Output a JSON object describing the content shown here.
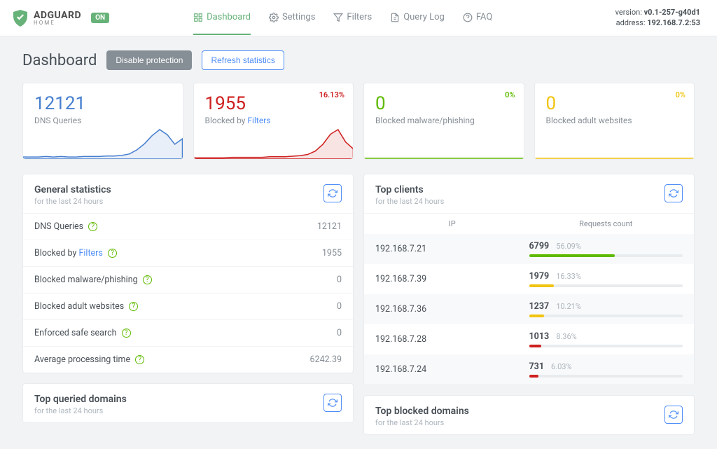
{
  "header": {
    "brand_main": "ADGUARD",
    "brand_sub": "HOME",
    "status_badge": "ON",
    "version_label": "version:",
    "version": "v0.1-257-g40d1",
    "address_label": "address:",
    "address": "192.168.7.2:53"
  },
  "nav": {
    "dashboard": "Dashboard",
    "settings": "Settings",
    "filters": "Filters",
    "querylog": "Query Log",
    "faq": "FAQ"
  },
  "page": {
    "title": "Dashboard",
    "disable_btn": "Disable protection",
    "refresh_btn": "Refresh statistics"
  },
  "cards": {
    "queries": {
      "value": "12121",
      "label": "DNS Queries"
    },
    "blocked": {
      "value": "1955",
      "label_prefix": "Blocked by ",
      "label_link": "Filters",
      "pct": "16.13%"
    },
    "malware": {
      "value": "0",
      "label": "Blocked malware/phishing",
      "pct": "0%"
    },
    "adult": {
      "value": "0",
      "label": "Blocked adult websites",
      "pct": "0%"
    }
  },
  "general": {
    "title": "General statistics",
    "sub": "for the last 24 hours",
    "rows": {
      "dns": {
        "k": "DNS Queries",
        "v": "12121"
      },
      "blocked": {
        "k_prefix": "Blocked by ",
        "k_link": "Filters",
        "v": "1955"
      },
      "malware": {
        "k": "Blocked malware/phishing",
        "v": "0"
      },
      "adult": {
        "k": "Blocked adult websites",
        "v": "0"
      },
      "safe": {
        "k": "Enforced safe search",
        "v": "0"
      },
      "avg": {
        "k": "Average processing time",
        "v": "6242.39"
      }
    }
  },
  "top_clients": {
    "title": "Top clients",
    "sub": "for the last 24 hours",
    "col_ip": "IP",
    "col_req": "Requests count",
    "rows": [
      {
        "ip": "192.168.7.21",
        "count": "6799",
        "pct": "56.09%",
        "bar": 56,
        "color": "#5eba00"
      },
      {
        "ip": "192.168.7.39",
        "count": "1979",
        "pct": "16.33%",
        "bar": 16,
        "color": "#f1c40f"
      },
      {
        "ip": "192.168.7.36",
        "count": "1237",
        "pct": "10.21%",
        "bar": 10,
        "color": "#f1c40f"
      },
      {
        "ip": "192.168.7.28",
        "count": "1013",
        "pct": "8.36%",
        "bar": 8,
        "color": "#cd201f"
      },
      {
        "ip": "192.168.7.24",
        "count": "731",
        "pct": "6.03%",
        "bar": 6,
        "color": "#cd201f"
      }
    ]
  },
  "top_queried": {
    "title": "Top queried domains",
    "sub": "for the last 24 hours"
  },
  "top_blocked": {
    "title": "Top blocked domains",
    "sub": "for the last 24 hours"
  },
  "chart_data": [
    {
      "type": "area",
      "series_name": "DNS Queries",
      "color": "#467fcf",
      "values": [
        4,
        4,
        4,
        5,
        4,
        5,
        4,
        4,
        5,
        5,
        5,
        6,
        6,
        7,
        10,
        18,
        30,
        46,
        58,
        48,
        29,
        40
      ]
    },
    {
      "type": "area",
      "series_name": "Blocked by Filters",
      "color": "#cd201f",
      "values": [
        2,
        2,
        2,
        2,
        2,
        3,
        3,
        3,
        3,
        3,
        4,
        4,
        4,
        5,
        6,
        8,
        14,
        26,
        44,
        52,
        30,
        18
      ]
    }
  ]
}
